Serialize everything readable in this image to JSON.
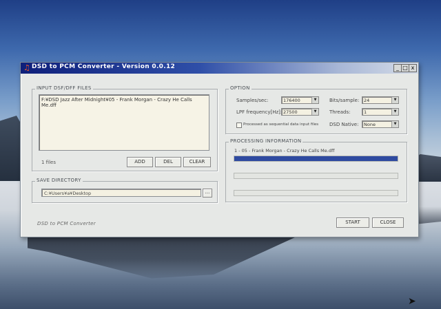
{
  "window": {
    "title": "DSD to PCM Converter - Version 0.0.12",
    "controls": {
      "minimize": "_",
      "maximize": "□",
      "close": "x"
    }
  },
  "input": {
    "group_label": "INPUT DSF/DFF FILES",
    "files": [
      "F:¥DSD Jazz After Midnight¥05 - Frank Morgan - Crazy He Calls Me.dff"
    ],
    "count_text": "1 files",
    "add_label": "ADD",
    "del_label": "DEL",
    "clear_label": "CLEAR"
  },
  "save": {
    "group_label": "SAVE DIRECTORY",
    "path": "C:¥Users¥a¥Desktop",
    "browse_label": "..."
  },
  "option": {
    "group_label": "OPTION",
    "samples_label": "Samples/sec:",
    "samples_value": "176400",
    "lpf_label": "LPF frequency[Hz]:",
    "lpf_value": "27500",
    "sequential_label": "Processed as sequential data input files",
    "bits_label": "Bits/sample:",
    "bits_value": "24",
    "threads_label": "Threads:",
    "threads_value": "1",
    "native_label": "DSD Native:",
    "native_value": "None"
  },
  "processing": {
    "group_label": "PROCESSING INFORMATION",
    "current_file": "1 - 05 - Frank Morgan - Crazy He Calls Me.dff",
    "progress": [
      1.0,
      0.0,
      0.0
    ]
  },
  "footer": {
    "brand": "DSD to PCM Converter",
    "start_label": "START",
    "close_label": "CLOSE"
  }
}
